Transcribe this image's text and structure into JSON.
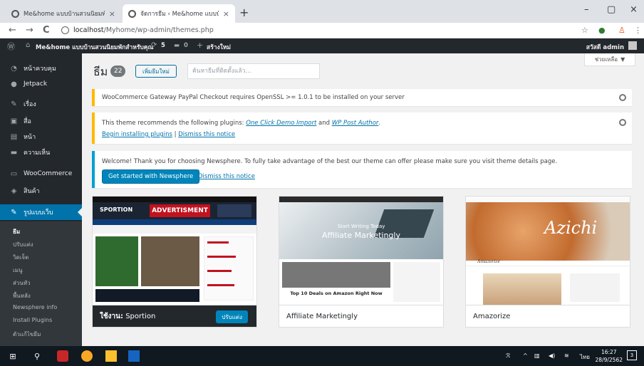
{
  "browser": {
    "tabs": [
      {
        "title": "Me&home แบบบ้านสวนนิยมพักสำหรั...",
        "close": "×"
      },
      {
        "title": "จัดการธีม ‹ Me&home แบบบ้านสวน...",
        "close": "×"
      }
    ],
    "new_tab": "+",
    "window_controls": {
      "minimize": "–",
      "maximize": "▢",
      "close": "×"
    },
    "back": "←",
    "forward": "→",
    "reload": "C",
    "url_host": "localhost",
    "url_path": "/Myhome/wp-admin/themes.php",
    "star": "☆",
    "menu": "⋮"
  },
  "admin_bar": {
    "site_name": "Me&home แบบบ้านสวนนิยมพักสำหรับคุณ",
    "updates_count": "5",
    "comments_count": "0",
    "new_label": "สร้างใหม่",
    "greeting": "สวัสดี admin"
  },
  "sidebar": {
    "items": [
      {
        "label": "หน้าควบคุม",
        "icon": "dashboard-icon",
        "glyph": "◔"
      },
      {
        "label": "Jetpack",
        "icon": "jetpack-icon",
        "glyph": "●"
      },
      {
        "label": "เรื่อง",
        "icon": "pin-icon",
        "glyph": "✎"
      },
      {
        "label": "สื่อ",
        "icon": "media-icon",
        "glyph": "▣"
      },
      {
        "label": "หน้า",
        "icon": "page-icon",
        "glyph": "▤"
      },
      {
        "label": "ความเห็น",
        "icon": "comments-icon",
        "glyph": "▬"
      },
      {
        "label": "WooCommerce",
        "icon": "woocommerce-icon",
        "glyph": "▭"
      },
      {
        "label": "สินค้า",
        "icon": "products-icon",
        "glyph": "◈"
      },
      {
        "label": "รูปแบบเว็บ",
        "icon": "appearance-icon",
        "glyph": "✎"
      }
    ],
    "submenu": [
      "ธีม",
      "ปรับแต่ง",
      "วิดเจ็ต",
      "เมนู",
      "ส่วนหัว",
      "พื้นหลัง",
      "Newsphere info",
      "Install Plugins",
      "ตัวแก้ไขธีม"
    ]
  },
  "main": {
    "help_tab": "ช่วยเหลือ",
    "help_arrow": "▼",
    "heading": "ธีม",
    "theme_count": "22",
    "add_new": "เพิ่มธีมใหม่",
    "search_placeholder": "ค้นหาธีมที่ติดตั้งแล้ว...",
    "notice_paypal": "WooCommerce Gateway PayPal Checkout requires OpenSSL >= 1.0.1 to be installed on your server",
    "notice_plugins": {
      "text": "This theme recommends the following plugins:",
      "plugin1": "One Click Demo Import",
      "and": "and",
      "plugin2": "WP Post Author",
      "period": ".",
      "install_link": "Begin installing plugins",
      "separator": "|",
      "dismiss_link": "Dismiss this notice"
    },
    "notice_welcome": {
      "text": "Welcome! Thank you for choosing Newsphere. To fully take advantage of the best our theme can offer please make sure you visit theme details page.",
      "button": "Get started with Newsphere",
      "dismiss": "Dismiss this notice"
    },
    "themes": [
      {
        "name": "Sportion",
        "active_prefix": "ใช้งาน:",
        "customize": "ปรับแต่ง",
        "shot_logo": "SPORTION",
        "shot_ad": "ADVERTISMENT"
      },
      {
        "name": "Affiliate Marketingly",
        "shot_sub": "Start Writing Today",
        "shot_title": "Affiliate Marketingly",
        "shot_deals": "Top 10 Deals on Amazon Right Now"
      },
      {
        "name": "Amazorize",
        "shot_title": "Azichi",
        "shot_brand": "Amazorize"
      }
    ]
  },
  "taskbar": {
    "start": "⊞",
    "search": "⚲",
    "tray_text": "ไทย",
    "time": "16:27",
    "date": "28/9/2562",
    "notif_count": "3"
  },
  "colors": {
    "admin_dark": "#23282d",
    "wp_blue": "#0073aa",
    "button_blue": "#0085ba",
    "warning_yellow": "#ffb900",
    "info_blue": "#00a0d2"
  }
}
